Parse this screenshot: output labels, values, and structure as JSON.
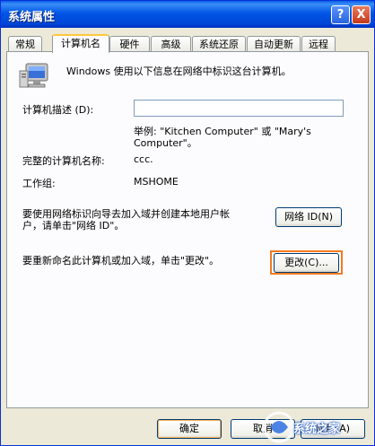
{
  "window": {
    "title": "系统属性",
    "help_label": "?",
    "close_label": "X"
  },
  "tabs": [
    {
      "label": "常规"
    },
    {
      "label": "计算机名"
    },
    {
      "label": "硬件"
    },
    {
      "label": "高级"
    },
    {
      "label": "系统还原"
    },
    {
      "label": "自动更新"
    },
    {
      "label": "远程"
    }
  ],
  "panel": {
    "intro": "Windows 使用以下信息在网络中标识这台计算机。",
    "description_label": "计算机描述 (D):",
    "description_value": "",
    "example_line1": "举例: \"Kitchen Computer\" 或 \"Mary's",
    "example_line2": "Computer\"。",
    "full_name_label": "完整的计算机名称:",
    "full_name_value": "ccc.",
    "workgroup_label": "工作组:",
    "workgroup_value": "MSHOME",
    "network_id_text_line1": "要使用网络标识向导去加入域并创建本地用户帐",
    "network_id_text_line2": "户，请单击\"网络 ID\"。",
    "network_id_button": "网络 ID(N)",
    "rename_text": "要重新命名此计算机或加入域，单击\"更改\"。",
    "change_button": "更改(C)..."
  },
  "footer": {
    "ok_button": "确定",
    "cancel_button": "取消",
    "apply_button": "应用(A)"
  },
  "watermark": {
    "text": "系统之家"
  },
  "colors": {
    "titlebar": "#0055e5",
    "highlight": "#f47b20",
    "dialog_bg": "#ece9d8"
  }
}
